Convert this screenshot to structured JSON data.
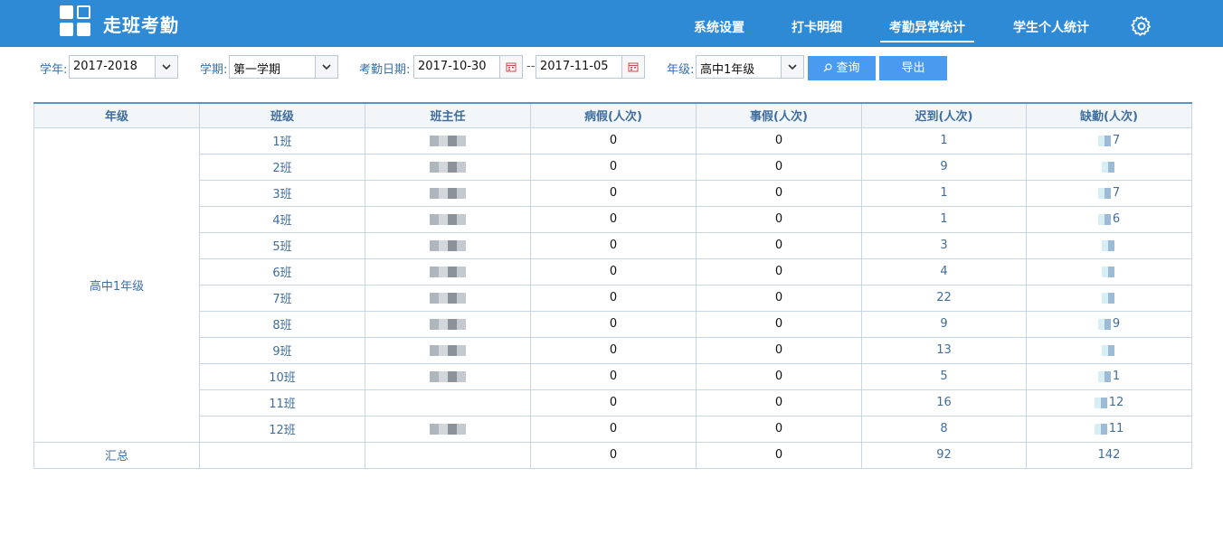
{
  "header": {
    "app_title": "走班考勤",
    "nav": [
      {
        "label": "系统设置",
        "active": false
      },
      {
        "label": "打卡明细",
        "active": false
      },
      {
        "label": "考勤异常统计",
        "active": true
      },
      {
        "label": "学生个人统计",
        "active": false
      }
    ]
  },
  "filters": {
    "year_label": "学年:",
    "year_value": "2017-2018",
    "term_label": "学期:",
    "term_value": "第一学期",
    "date_label": "考勤日期:",
    "date_start": "2017-10-30",
    "date_sep": "--",
    "date_end": "2017-11-05",
    "grade_label": "年级:",
    "grade_value": "高中1年级",
    "query_button": "查询",
    "export_button": "导出"
  },
  "table": {
    "headers": [
      "年级",
      "班级",
      "班主任",
      "病假(人次)",
      "事假(人次)",
      "迟到(人次)",
      "缺勤(人次)"
    ],
    "grade": "高中1年级",
    "rows": [
      {
        "class": "1班",
        "sick": "0",
        "personal": "0",
        "late": "1",
        "absent": "7"
      },
      {
        "class": "2班",
        "sick": "0",
        "personal": "0",
        "late": "9",
        "absent": ""
      },
      {
        "class": "3班",
        "sick": "0",
        "personal": "0",
        "late": "1",
        "absent": "7"
      },
      {
        "class": "4班",
        "sick": "0",
        "personal": "0",
        "late": "1",
        "absent": "6"
      },
      {
        "class": "5班",
        "sick": "0",
        "personal": "0",
        "late": "3",
        "absent": ""
      },
      {
        "class": "6班",
        "sick": "0",
        "personal": "0",
        "late": "4",
        "absent": ""
      },
      {
        "class": "7班",
        "sick": "0",
        "personal": "0",
        "late": "22",
        "absent": ""
      },
      {
        "class": "8班",
        "sick": "0",
        "personal": "0",
        "late": "9",
        "absent": "9"
      },
      {
        "class": "9班",
        "sick": "0",
        "personal": "0",
        "late": "13",
        "absent": ""
      },
      {
        "class": "10班",
        "sick": "0",
        "personal": "0",
        "late": "5",
        "absent": "1"
      },
      {
        "class": "11班",
        "sick": "0",
        "personal": "0",
        "late": "16",
        "absent": "12"
      },
      {
        "class": "12班",
        "sick": "0",
        "personal": "0",
        "late": "8",
        "absent": "11"
      }
    ],
    "total": {
      "label": "汇总",
      "sick": "0",
      "personal": "0",
      "late": "92",
      "absent": "142"
    }
  },
  "colors": {
    "topbar": "#2f8ad6",
    "header_text": "#3f6e9e",
    "button": "#4a9bf0"
  },
  "icons": [
    "logo-grid-icon",
    "settings-gear-icon",
    "chevron-down-icon",
    "calendar-icon",
    "search-icon"
  ]
}
